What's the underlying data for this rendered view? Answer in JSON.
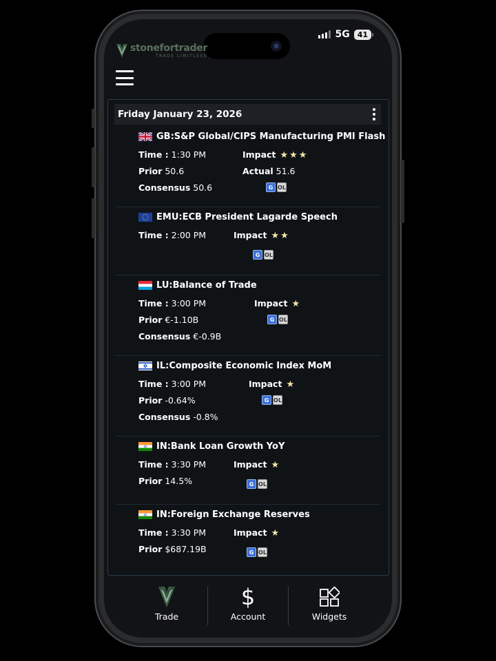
{
  "status_bar": {
    "network": "5G",
    "battery": "41"
  },
  "brand": {
    "name": "stonefortrader",
    "tagline": "TRADE LIMITLESS"
  },
  "calendar": {
    "date": "Friday January 23, 2026",
    "events": [
      {
        "country": "GB",
        "title": "GB:S&P Global/CIPS Manufacturing PMI Flash",
        "time_label": "Time :",
        "time": "1:30 PM",
        "impact_label": "Impact",
        "impact": 3,
        "impact_stars": "★★★",
        "prior_label": "Prior",
        "prior": "50.6",
        "actual_label": "Actual",
        "actual": "51.6",
        "consensus_label": "Consensus",
        "consensus": "50.6"
      },
      {
        "country": "EMU",
        "title": "EMU:ECB President Lagarde Speech",
        "time_label": "Time :",
        "time": "2:00 PM",
        "impact_label": "Impact",
        "impact": 2,
        "impact_stars": "★★"
      },
      {
        "country": "LU",
        "title": "LU:Balance of Trade",
        "time_label": "Time :",
        "time": "3:00 PM",
        "impact_label": "Impact",
        "impact": 1,
        "impact_stars": "★",
        "prior_label": "Prior",
        "prior": "€-1.10B",
        "consensus_label": "Consensus",
        "consensus": "€-0.9B"
      },
      {
        "country": "IL",
        "title": "IL:Composite Economic Index MoM",
        "time_label": "Time :",
        "time": "3:00 PM",
        "impact_label": "Impact",
        "impact": 1,
        "impact_stars": "★",
        "prior_label": "Prior",
        "prior": "-0.64%",
        "consensus_label": "Consensus",
        "consensus": "-0.8%"
      },
      {
        "country": "IN",
        "title": "IN:Bank Loan Growth YoY",
        "time_label": "Time :",
        "time": "3:30 PM",
        "impact_label": "Impact",
        "impact": 1,
        "impact_stars": "★",
        "prior_label": "Prior",
        "prior": "14.5%"
      },
      {
        "country": "IN",
        "title": "IN:Foreign Exchange Reserves",
        "time_label": "Time :",
        "time": "3:30 PM",
        "impact_label": "Impact",
        "impact": 1,
        "impact_stars": "★",
        "prior_label": "Prior",
        "prior": "$687.19B"
      }
    ],
    "action_icons": {
      "g": "G",
      "ol": "OL"
    }
  },
  "tabbar": [
    {
      "label": "Trade",
      "icon": "trade-logo-icon"
    },
    {
      "label": "Account",
      "icon": "dollar-icon"
    },
    {
      "label": "Widgets",
      "icon": "widgets-icon"
    }
  ],
  "colors": {
    "accent": "#57705c",
    "star": "#f3e6a6",
    "card_border": "#2c3b4c",
    "icon_g": "#3b6fd8"
  }
}
